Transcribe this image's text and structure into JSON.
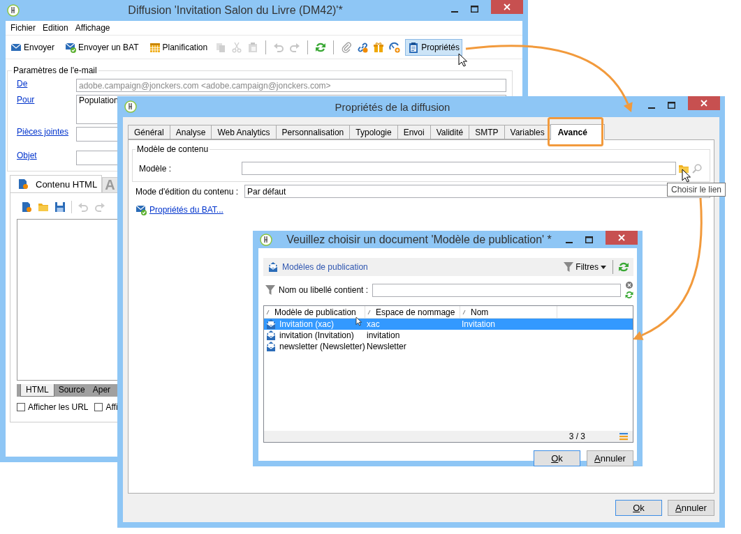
{
  "main_window": {
    "title": "Diffusion 'Invitation Salon du Livre  (DM42)'*",
    "menu": [
      "Fichier",
      "Edition",
      "Affichage"
    ],
    "toolbar": [
      {
        "kind": "button",
        "label": "Envoyer",
        "pressed": false
      },
      {
        "kind": "button",
        "label": "Envoyer un BAT",
        "pressed": false
      },
      {
        "kind": "button",
        "label": "Planification",
        "pressed": false
      },
      {
        "kind": "icon",
        "disabled": true
      },
      {
        "kind": "icon",
        "disabled": true
      },
      {
        "kind": "icon",
        "disabled": true
      },
      {
        "kind": "separator"
      },
      {
        "kind": "icon",
        "disabled": true
      },
      {
        "kind": "icon",
        "disabled": true
      },
      {
        "kind": "separator"
      },
      {
        "kind": "icon",
        "disabled": false
      },
      {
        "kind": "separator"
      },
      {
        "kind": "icon",
        "disabled": false
      },
      {
        "kind": "icon",
        "disabled": false
      },
      {
        "kind": "icon",
        "disabled": false
      },
      {
        "kind": "icon",
        "disabled": false
      },
      {
        "kind": "button",
        "label": "Propriétés",
        "pressed": true
      }
    ],
    "email_group": {
      "title": "Paramètres de l'e-mail",
      "fields": [
        {
          "label": "De",
          "value": "adobe.campaign@jonckers.com <adobe.campaign@jonckers.com>"
        },
        {
          "label": "Pour",
          "value": "Population"
        },
        {
          "label": "Pièces jointes"
        },
        {
          "label": "Objet"
        }
      ]
    },
    "content_tabs": [
      {
        "label": "Contenu HTML",
        "selected": true
      },
      {
        "label": "A",
        "selected": false
      }
    ],
    "view_tabs": [
      {
        "label": "HTML",
        "selected": true
      },
      {
        "label": "Source",
        "selected": false
      },
      {
        "label": "Aper",
        "selected": false
      }
    ],
    "options": [
      {
        "label": "Afficher les URL",
        "checked": false
      },
      {
        "label": "Affi",
        "checked": false
      }
    ]
  },
  "properties_window": {
    "title": "Propriétés de la diffusion",
    "tabs": [
      {
        "label": "Général",
        "selected": false
      },
      {
        "label": "Analyse",
        "selected": false
      },
      {
        "label": "Web Analytics",
        "selected": false
      },
      {
        "label": "Personnalisation",
        "selected": false
      },
      {
        "label": "Typologie",
        "selected": false
      },
      {
        "label": "Envoi",
        "selected": false
      },
      {
        "label": "Validité",
        "selected": false
      },
      {
        "label": "SMTP",
        "selected": false
      },
      {
        "label": "Variables",
        "selected": false
      },
      {
        "label": "Avancé",
        "selected": true
      }
    ],
    "group_title": "Modèle de contenu",
    "model_label": "Modèle :",
    "mode_label": "Mode d'édition du contenu :",
    "mode_value": "Par défaut",
    "bat_link": "Propriétés du BAT...",
    "tooltip": "Choisir le lien",
    "buttons": [
      "Ok",
      "Annuler"
    ]
  },
  "chooser_window": {
    "title": "Veuillez choisir un document 'Modèle de publication' *",
    "folder": "Modèles de publication",
    "filter_button": "Filtres",
    "filter_label": "Nom ou libellé contient :",
    "columns": [
      "Modèle de publication",
      "Espace de nommage",
      "Nom"
    ],
    "rows": [
      {
        "cells": [
          "Invitation (xac)",
          "xac",
          "Invitation"
        ],
        "selected": true
      },
      {
        "cells": [
          "invitation (Invitation)",
          "invitation"
        ],
        "selected": false
      },
      {
        "cells": [
          "newsletter (Newsletter)",
          "Newsletter"
        ],
        "selected": false
      }
    ],
    "count": "3 / 3",
    "buttons": [
      "Ok",
      "Annuler"
    ]
  }
}
